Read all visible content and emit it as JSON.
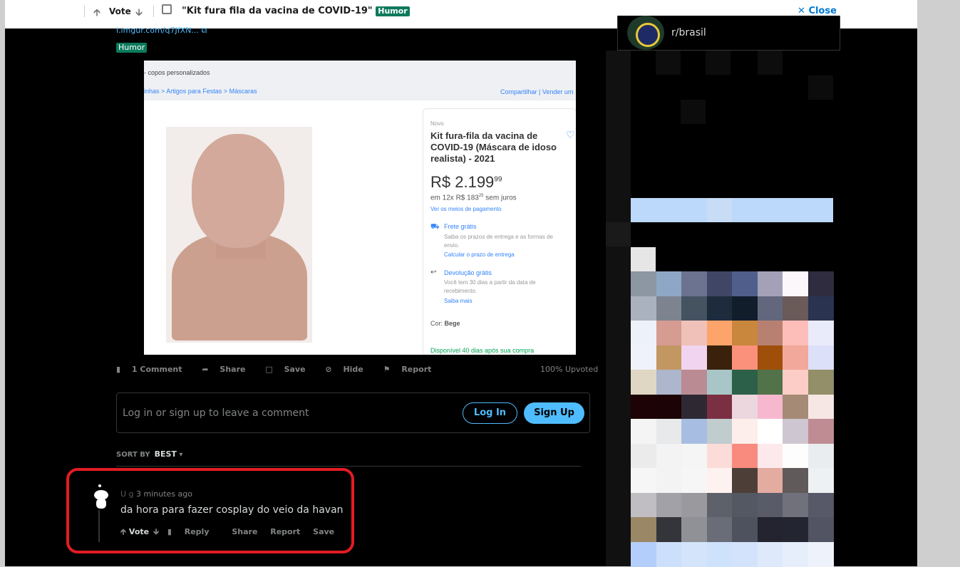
{
  "topbar": {
    "vote_label": "Vote",
    "post_title": "\"Kit fura fila da vacina de COVID-19\"",
    "flair": "Humor",
    "close_label": "Close"
  },
  "post": {
    "link_text": "i.imgur.com/q7JfXN...",
    "flair": "Humor",
    "image": {
      "header_text": "- copos personalizados",
      "breadcrumb": "inhas > Artigos para Festas > Máscaras",
      "header_links": "Compartilhar | Vender um",
      "badge": "Novo",
      "product_title_1": "Kit fura-fila da vacina de",
      "product_title_2": "COVID-19 (Máscara de idoso",
      "product_title_3": "realista) - 2021",
      "price": "R$ 2.199",
      "price_cents": "99",
      "installments": "em 12x R$ 183",
      "installment_cents": "25",
      "installments_suffix": "sem juros",
      "payment_link": "Ver os meios de pagamento",
      "shipping_title": "Frete grátis",
      "shipping_text_1": "Saiba os prazos de entrega e as formas de",
      "shipping_text_2": "envio.",
      "shipping_link": "Calcular o prazo de entrega",
      "return_title": "Devolução grátis",
      "return_text_1": "Você tem 30 dias a partir da data de",
      "return_text_2": "recebimento.",
      "return_link": "Saiba mais",
      "color_label": "Cor:",
      "color_value": "Bege",
      "availability": "Disponível 40 dias após sua compra"
    },
    "actions": {
      "comments": "1 Comment",
      "share": "Share",
      "save": "Save",
      "hide": "Hide",
      "report": "Report"
    },
    "upvoted": "100% Upvoted"
  },
  "comment_prompt": {
    "text": "Log in or sign up to leave a comment",
    "login_label": "Log In",
    "signup_label": "Sign Up"
  },
  "sort": {
    "label": "SORT BY",
    "value": "BEST"
  },
  "comment": {
    "author_obscured": "U    g",
    "time": "3 minutes ago",
    "text": "da hora para fazer cosplay do veio da havan",
    "vote_label": "Vote",
    "reply": "Reply",
    "share": "Share",
    "report": "Report",
    "save": "Save"
  },
  "sidebar": {
    "subreddit": "r/brasil"
  },
  "colors": {
    "accent_blue": "#4fbcff",
    "flair_green": "#0b7a5c",
    "highlight_red": "#e31c23"
  }
}
